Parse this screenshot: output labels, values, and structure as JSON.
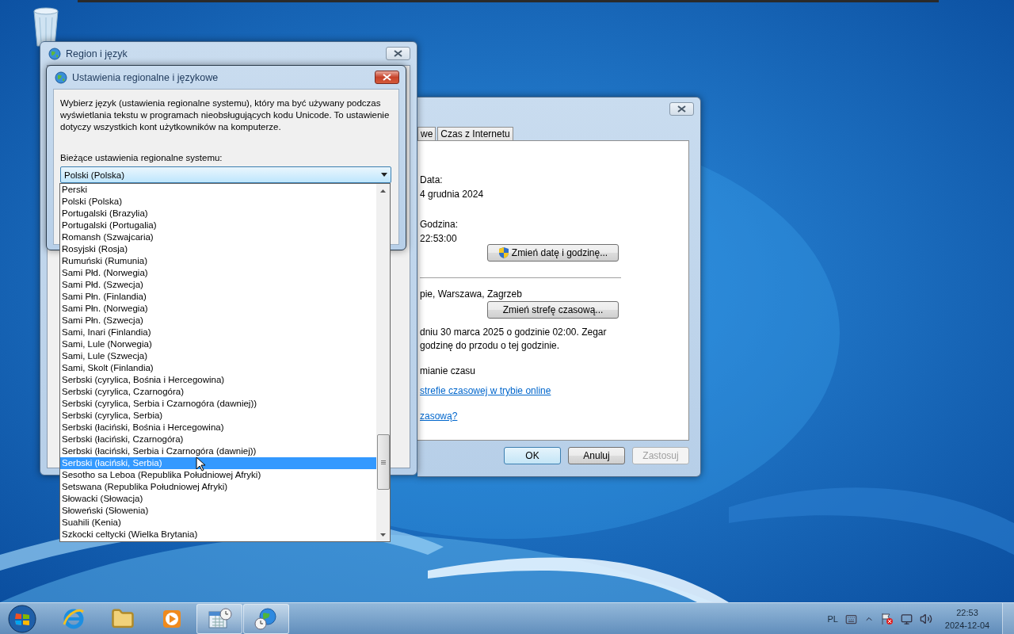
{
  "region_window": {
    "title": "Region i język"
  },
  "datetime_window": {
    "tabs": [
      {
        "label": "we",
        "selected": false
      },
      {
        "label": "Czas z Internetu",
        "selected": false
      }
    ],
    "date_label": "Data:",
    "date": "4 grudnia 2024",
    "time_label": "Godzina:",
    "time": "22:53:00",
    "change_datetime_button": "Zmień datę i godzinę...",
    "timezone": "pie, Warszawa, Zagrzeb",
    "change_timezone_button": "Zmień strefę czasową...",
    "dst_note": [
      "dniu 30 marca 2025 o godzinie 02:00. Zegar",
      "godzinę do przodu o tej godzinie."
    ],
    "dst_option": "mianie czasu",
    "links": [
      "strefie czasowej w trybie online",
      "zasową?"
    ],
    "buttons": [
      {
        "label": "OK",
        "default": true,
        "disabled": false
      },
      {
        "label": "Anuluj",
        "default": false,
        "disabled": false
      },
      {
        "label": "Zastosuj",
        "default": false,
        "disabled": true
      }
    ]
  },
  "locale_dialog": {
    "title": "Ustawienia regionalne i językowe",
    "description": "Wybierz język (ustawienia regionalne systemu), który ma być używany podczas wyświetlania tekstu w programach nieobsługujących kodu Unicode. To ustawienie dotyczy wszystkich kont użytkowników na komputerze.",
    "field_label": "Bieżące ustawienia regionalne systemu:",
    "combo": {
      "value": "Polski (Polska)",
      "expanded": true
    },
    "options": [
      {
        "label": "Perski",
        "selected": false
      },
      {
        "label": "Polski (Polska)",
        "selected": false
      },
      {
        "label": "Portugalski (Brazylia)",
        "selected": false
      },
      {
        "label": "Portugalski (Portugalia)",
        "selected": false
      },
      {
        "label": "Romansh (Szwajcaria)",
        "selected": false
      },
      {
        "label": "Rosyjski (Rosja)",
        "selected": false
      },
      {
        "label": "Rumuński (Rumunia)",
        "selected": false
      },
      {
        "label": "Sami Płd. (Norwegia)",
        "selected": false
      },
      {
        "label": "Sami Płd. (Szwecja)",
        "selected": false
      },
      {
        "label": "Sami Płn. (Finlandia)",
        "selected": false
      },
      {
        "label": "Sami Płn. (Norwegia)",
        "selected": false
      },
      {
        "label": "Sami Płn. (Szwecja)",
        "selected": false
      },
      {
        "label": "Sami, Inari (Finlandia)",
        "selected": false
      },
      {
        "label": "Sami, Lule (Norwegia)",
        "selected": false
      },
      {
        "label": "Sami, Lule (Szwecja)",
        "selected": false
      },
      {
        "label": "Sami, Skolt (Finlandia)",
        "selected": false
      },
      {
        "label": "Serbski (cyrylica, Bośnia i Hercegowina)",
        "selected": false
      },
      {
        "label": "Serbski (cyrylica, Czarnogóra)",
        "selected": false
      },
      {
        "label": "Serbski (cyrylica, Serbia i Czarnogóra (dawniej))",
        "selected": false
      },
      {
        "label": "Serbski (cyrylica, Serbia)",
        "selected": false
      },
      {
        "label": "Serbski (łaciński, Bośnia i Hercegowina)",
        "selected": false
      },
      {
        "label": "Serbski (łaciński, Czarnogóra)",
        "selected": false
      },
      {
        "label": "Serbski (łaciński, Serbia i Czarnogóra (dawniej))",
        "selected": false
      },
      {
        "label": "Serbski (łaciński, Serbia)",
        "selected": true
      },
      {
        "label": "Sesotho sa Leboa (Republika Południowej Afryki)",
        "selected": false
      },
      {
        "label": "Setswana (Republika Południowej Afryki)",
        "selected": false
      },
      {
        "label": "Słowacki (Słowacja)",
        "selected": false
      },
      {
        "label": "Słoweński (Słowenia)",
        "selected": false
      },
      {
        "label": "Suahili (Kenia)",
        "selected": false
      },
      {
        "label": "Szkocki celtycki (Wielka Brytania)",
        "selected": false
      }
    ]
  },
  "taskbar": {
    "apps": [
      {
        "kind": "browser",
        "active": false
      },
      {
        "kind": "folder",
        "active": false
      },
      {
        "kind": "media",
        "active": false
      },
      {
        "kind": "calendar",
        "active": true
      },
      {
        "kind": "globe",
        "active": true
      }
    ],
    "tray": {
      "language": "PL",
      "time": "22:53",
      "date": "2024-12-04"
    }
  }
}
